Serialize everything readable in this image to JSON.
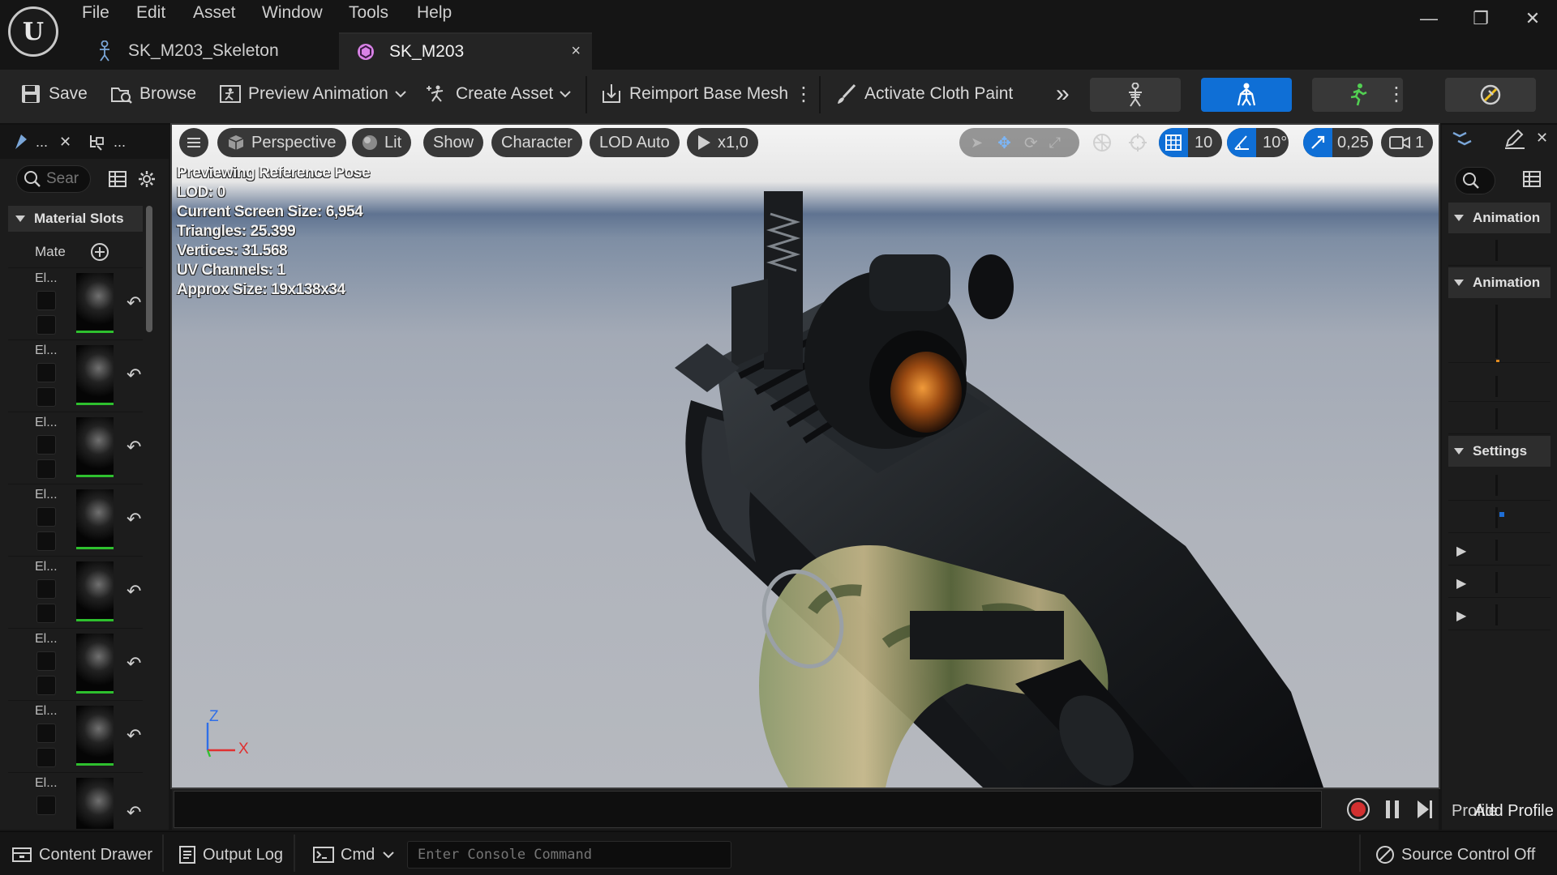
{
  "app": {
    "menu": [
      "File",
      "Edit",
      "Asset",
      "Window",
      "Tools",
      "Help"
    ],
    "tabs": [
      {
        "label": "SK_M203_Skeleton",
        "active": false
      },
      {
        "label": "SK_M203",
        "active": true,
        "close": "×"
      }
    ],
    "window_controls": {
      "minimize": "—",
      "restore": "❐",
      "close": "✕"
    }
  },
  "toolbar": {
    "save": "Save",
    "browse": "Browse",
    "preview_animation": "Preview Animation",
    "create_asset": "Create Asset",
    "reimport": "Reimport Base Mesh",
    "cloth_paint": "Activate Cloth Paint",
    "overflow": "»",
    "modes": [
      "skeleton-mode",
      "mesh-mode",
      "animation-mode"
    ],
    "active_mode": "mesh-mode",
    "accent": "#0f6fd6"
  },
  "left_panel": {
    "tab1": "...",
    "tab2": "...",
    "search_placeholder": "Sear",
    "section": "Material Slots",
    "mat_label": "Mate",
    "elements": [
      {
        "label": "El..."
      },
      {
        "label": "El..."
      },
      {
        "label": "El..."
      },
      {
        "label": "El..."
      },
      {
        "label": "El..."
      },
      {
        "label": "El..."
      },
      {
        "label": "El..."
      },
      {
        "label": "El..."
      }
    ]
  },
  "viewport": {
    "buttons": {
      "perspective": "Perspective",
      "lit": "Lit",
      "show": "Show",
      "character": "Character",
      "lod": "LOD Auto",
      "play_speed": "x1,0",
      "grid_snap": "10",
      "rotate_snap": "10°",
      "scale_snap": "0,25",
      "camera_speed": "1"
    },
    "stats": [
      "Previewing Reference Pose",
      "LOD: 0",
      "Current Screen Size: 6,954",
      "Triangles: 25.399",
      "Vertices: 31.568",
      "UV Channels: 1",
      "Approx Size: 19x138x34"
    ],
    "axis": {
      "z": "Z",
      "x": "X"
    }
  },
  "right_panel": {
    "sections": [
      "Animation",
      "Animation",
      "Settings"
    ],
    "profile_label": "Profile",
    "add_profile": "Add Profile"
  },
  "statusbar": {
    "content_drawer": "Content Drawer",
    "output_log": "Output Log",
    "cmd": "Cmd",
    "console_placeholder": "Enter Console Command",
    "source_control": "Source Control Off"
  }
}
